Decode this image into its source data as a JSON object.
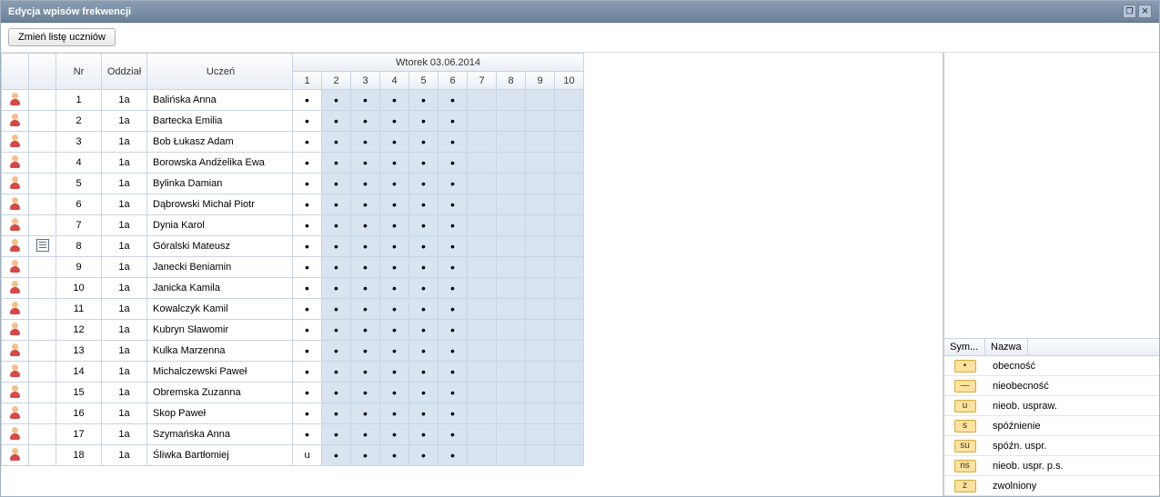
{
  "window": {
    "title": "Edycja wpisów frekwencji"
  },
  "toolbar": {
    "change_list_btn": "Zmień listę uczniów"
  },
  "grid": {
    "headers": {
      "nr": "Nr",
      "oddzial": "Oddział",
      "uczen": "Uczeń",
      "date_header": "Wtorek 03.06.2014",
      "lessons": [
        "1",
        "2",
        "3",
        "4",
        "5",
        "6",
        "7",
        "8",
        "9",
        "10"
      ]
    },
    "rows": [
      {
        "nr": "1",
        "oddzial": "1a",
        "name": "Balińska Anna",
        "note": false,
        "cells": [
          "•",
          "•",
          "•",
          "•",
          "•",
          "•",
          "",
          "",
          "",
          ""
        ]
      },
      {
        "nr": "2",
        "oddzial": "1a",
        "name": "Bartecka Emilia",
        "note": false,
        "cells": [
          "•",
          "•",
          "•",
          "•",
          "•",
          "•",
          "",
          "",
          "",
          ""
        ]
      },
      {
        "nr": "3",
        "oddzial": "1a",
        "name": "Bob Łukasz Adam",
        "note": false,
        "cells": [
          "•",
          "•",
          "•",
          "•",
          "•",
          "•",
          "",
          "",
          "",
          ""
        ]
      },
      {
        "nr": "4",
        "oddzial": "1a",
        "name": "Borowska Andżelika Ewa",
        "note": false,
        "cells": [
          "•",
          "•",
          "•",
          "•",
          "•",
          "•",
          "",
          "",
          "",
          ""
        ]
      },
      {
        "nr": "5",
        "oddzial": "1a",
        "name": "Bylinka Damian",
        "note": false,
        "cells": [
          "•",
          "•",
          "•",
          "•",
          "•",
          "•",
          "",
          "",
          "",
          ""
        ]
      },
      {
        "nr": "6",
        "oddzial": "1a",
        "name": "Dąbrowski Michał Piotr",
        "note": false,
        "cells": [
          "•",
          "•",
          "•",
          "•",
          "•",
          "•",
          "",
          "",
          "",
          ""
        ]
      },
      {
        "nr": "7",
        "oddzial": "1a",
        "name": "Dynia Karol",
        "note": false,
        "cells": [
          "•",
          "•",
          "•",
          "•",
          "•",
          "•",
          "",
          "",
          "",
          ""
        ]
      },
      {
        "nr": "8",
        "oddzial": "1a",
        "name": "Góralski Mateusz",
        "note": true,
        "cells": [
          "•",
          "•",
          "•",
          "•",
          "•",
          "•",
          "",
          "",
          "",
          ""
        ]
      },
      {
        "nr": "9",
        "oddzial": "1a",
        "name": "Janecki Beniamin",
        "note": false,
        "cells": [
          "•",
          "•",
          "•",
          "•",
          "•",
          "•",
          "",
          "",
          "",
          ""
        ]
      },
      {
        "nr": "10",
        "oddzial": "1a",
        "name": "Janicka Kamila",
        "note": false,
        "cells": [
          "•",
          "•",
          "•",
          "•",
          "•",
          "•",
          "",
          "",
          "",
          ""
        ]
      },
      {
        "nr": "11",
        "oddzial": "1a",
        "name": "Kowalczyk Kamil",
        "note": false,
        "cells": [
          "•",
          "•",
          "•",
          "•",
          "•",
          "•",
          "",
          "",
          "",
          ""
        ]
      },
      {
        "nr": "12",
        "oddzial": "1a",
        "name": "Kubryn Sławomir",
        "note": false,
        "cells": [
          "•",
          "•",
          "•",
          "•",
          "•",
          "•",
          "",
          "",
          "",
          ""
        ]
      },
      {
        "nr": "13",
        "oddzial": "1a",
        "name": "Kulka Marzenna",
        "note": false,
        "cells": [
          "•",
          "•",
          "•",
          "•",
          "•",
          "•",
          "",
          "",
          "",
          ""
        ]
      },
      {
        "nr": "14",
        "oddzial": "1a",
        "name": "Michalczewski Paweł",
        "note": false,
        "cells": [
          "•",
          "•",
          "•",
          "•",
          "•",
          "•",
          "",
          "",
          "",
          ""
        ]
      },
      {
        "nr": "15",
        "oddzial": "1a",
        "name": "Obremska Zuzanna",
        "note": false,
        "cells": [
          "•",
          "•",
          "•",
          "•",
          "•",
          "•",
          "",
          "",
          "",
          ""
        ]
      },
      {
        "nr": "16",
        "oddzial": "1a",
        "name": "Skop Paweł",
        "note": false,
        "cells": [
          "•",
          "•",
          "•",
          "•",
          "•",
          "•",
          "",
          "",
          "",
          ""
        ]
      },
      {
        "nr": "17",
        "oddzial": "1a",
        "name": "Szymańska Anna",
        "note": false,
        "cells": [
          "•",
          "•",
          "•",
          "•",
          "•",
          "•",
          "",
          "",
          "",
          ""
        ]
      },
      {
        "nr": "18",
        "oddzial": "1a",
        "name": "Śliwka Bartłomiej",
        "note": false,
        "cells": [
          "u",
          "•",
          "•",
          "•",
          "•",
          "•",
          "",
          "",
          "",
          ""
        ]
      }
    ]
  },
  "legend": {
    "header_sym": "Sym...",
    "header_name": "Nazwa",
    "items": [
      {
        "sym": "•",
        "name": "obecność"
      },
      {
        "sym": "—",
        "name": "nieobecność"
      },
      {
        "sym": "u",
        "name": "nieob. uspraw."
      },
      {
        "sym": "s",
        "name": "spóźnienie"
      },
      {
        "sym": "su",
        "name": "spóźn. uspr."
      },
      {
        "sym": "ns",
        "name": "nieob. uspr. p.s."
      },
      {
        "sym": "z",
        "name": "zwolniony"
      }
    ]
  }
}
